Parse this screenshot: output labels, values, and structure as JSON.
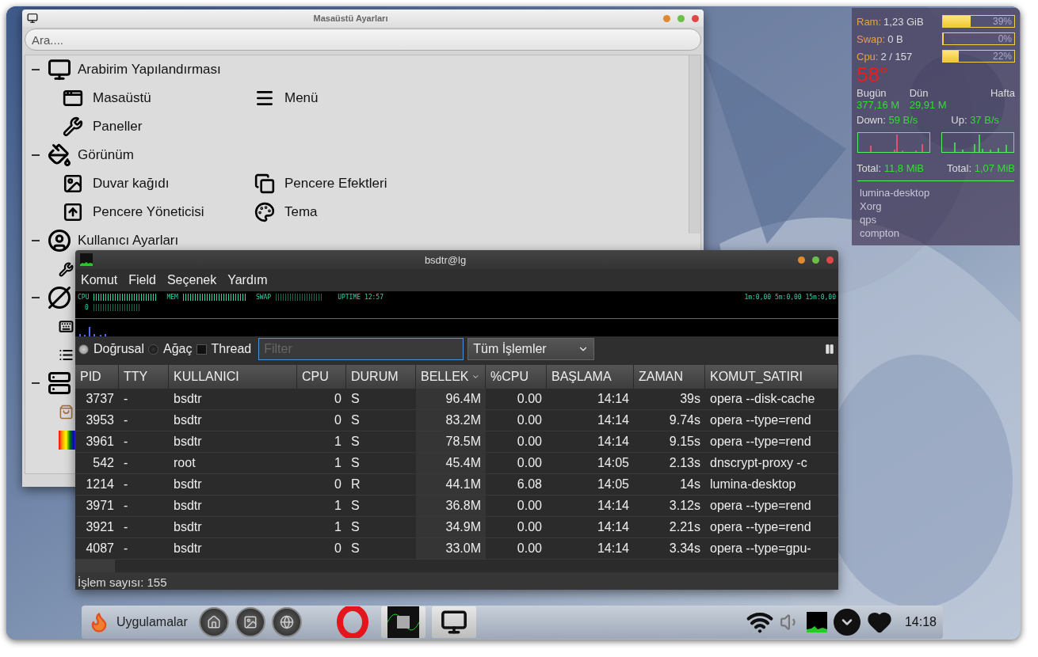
{
  "settings_window": {
    "title": "Masaüstü Ayarları",
    "search": {
      "placeholder": "Ara...."
    },
    "categories": [
      {
        "label": "Arabirim Yapılandırması",
        "expanded": true,
        "items": [
          {
            "label": "Masaüstü"
          },
          {
            "label": "Menü"
          },
          {
            "label": "Paneller"
          }
        ]
      },
      {
        "label": "Görünüm",
        "expanded": true,
        "items": [
          {
            "label": "Duvar kağıdı"
          },
          {
            "label": "Pencere Efektleri"
          },
          {
            "label": "Pencere Yöneticisi"
          },
          {
            "label": "Tema"
          }
        ]
      },
      {
        "label": "Kullanıcı Ayarları",
        "expanded": true
      }
    ]
  },
  "process_window": {
    "title": "bsdtr@lg",
    "menu": [
      "Komut",
      "Field",
      "Seçenek",
      "Yardım"
    ],
    "header": {
      "cpu_label": "CPU",
      "cpu_value": "0",
      "mem_label": "MEM",
      "swap_label": "SWAP",
      "uptime": "UPTIME 12:57",
      "load": "1m:0,00 5m:0,00 15m:0,00"
    },
    "view_options": [
      {
        "kind": "radio",
        "label": "Doğrusal",
        "selected": true
      },
      {
        "kind": "radio",
        "label": "Ağaç",
        "selected": false
      },
      {
        "kind": "checkbox",
        "label": "Thread",
        "checked": false
      }
    ],
    "filter": {
      "placeholder": "Filter"
    },
    "process_filter": "Tüm İşlemler",
    "table": {
      "columns": [
        {
          "label": "PID",
          "sorted": false
        },
        {
          "label": "TTY",
          "sorted": false
        },
        {
          "label": "KULLANICI",
          "sorted": false
        },
        {
          "label": "CPU",
          "sorted": false
        },
        {
          "label": "DURUM",
          "sorted": false
        },
        {
          "label": "BELLEK",
          "sorted": true
        },
        {
          "label": "%CPU",
          "sorted": false
        },
        {
          "label": "BAŞLAMA",
          "sorted": false
        },
        {
          "label": "ZAMAN",
          "sorted": false
        },
        {
          "label": "KOMUT_SATIRI",
          "sorted": false
        }
      ],
      "rows": [
        [
          "3737",
          "-",
          "bsdtr",
          "0",
          "S",
          "96.4M",
          "0.00",
          "14:14",
          "39s",
          "opera --disk-cache"
        ],
        [
          "3953",
          "-",
          "bsdtr",
          "0",
          "S",
          "83.2M",
          "0.00",
          "14:14",
          "9.74s",
          "opera --type=rend"
        ],
        [
          "3961",
          "-",
          "bsdtr",
          "1",
          "S",
          "78.5M",
          "0.00",
          "14:14",
          "9.15s",
          "opera --type=rend"
        ],
        [
          "542",
          "-",
          "root",
          "1",
          "S",
          "45.4M",
          "0.00",
          "14:05",
          "2.13s",
          "dnscrypt-proxy -c"
        ],
        [
          "1214",
          "-",
          "bsdtr",
          "0",
          "R",
          "44.1M",
          "6.08",
          "14:05",
          "14s",
          "lumina-desktop"
        ],
        [
          "3971",
          "-",
          "bsdtr",
          "1",
          "S",
          "36.8M",
          "0.00",
          "14:14",
          "3.12s",
          "opera --type=rend"
        ],
        [
          "3921",
          "-",
          "bsdtr",
          "1",
          "S",
          "34.9M",
          "0.00",
          "14:14",
          "2.21s",
          "opera --type=rend"
        ],
        [
          "4087",
          "-",
          "bsdtr",
          "0",
          "S",
          "33.0M",
          "0.00",
          "14:14",
          "3.34s",
          "opera --type=gpu-"
        ]
      ]
    },
    "status": "İşlem sayısı: 155"
  },
  "conky": {
    "meters": [
      {
        "label": "Ram:",
        "value": "1,23 GiB",
        "level": 0.39,
        "reading": "39%"
      },
      {
        "label": "Swap:",
        "value": "0 B",
        "level": 0,
        "reading": "0%"
      },
      {
        "label": "Cpu:",
        "value": "2 / 157",
        "level": 0.22,
        "reading": "22%"
      }
    ],
    "temperature": "58°",
    "traffic": [
      {
        "label": "Bugün",
        "value": "377,16 M"
      },
      {
        "label": "Dün",
        "value": "29,91 M"
      },
      {
        "label": "Hafta"
      }
    ],
    "down": {
      "label": "Down:",
      "rate": "59 B/s",
      "total_label": "Total:",
      "total": "11,8 MiB"
    },
    "up": {
      "label": "Up:",
      "rate": "37 B/s",
      "total_label": "Total:",
      "total": "1,07 MiB"
    },
    "processes": [
      "lumina-desktop",
      "Xorg",
      "qps",
      "compton"
    ]
  },
  "taskbar": {
    "menu_label": "Uygulamalar",
    "tasks": [
      {
        "kind": "browser",
        "selected": false
      },
      {
        "kind": "cpu-monitor",
        "selected": true
      },
      {
        "kind": "settings",
        "selected": true
      }
    ],
    "clock": "14:18"
  }
}
